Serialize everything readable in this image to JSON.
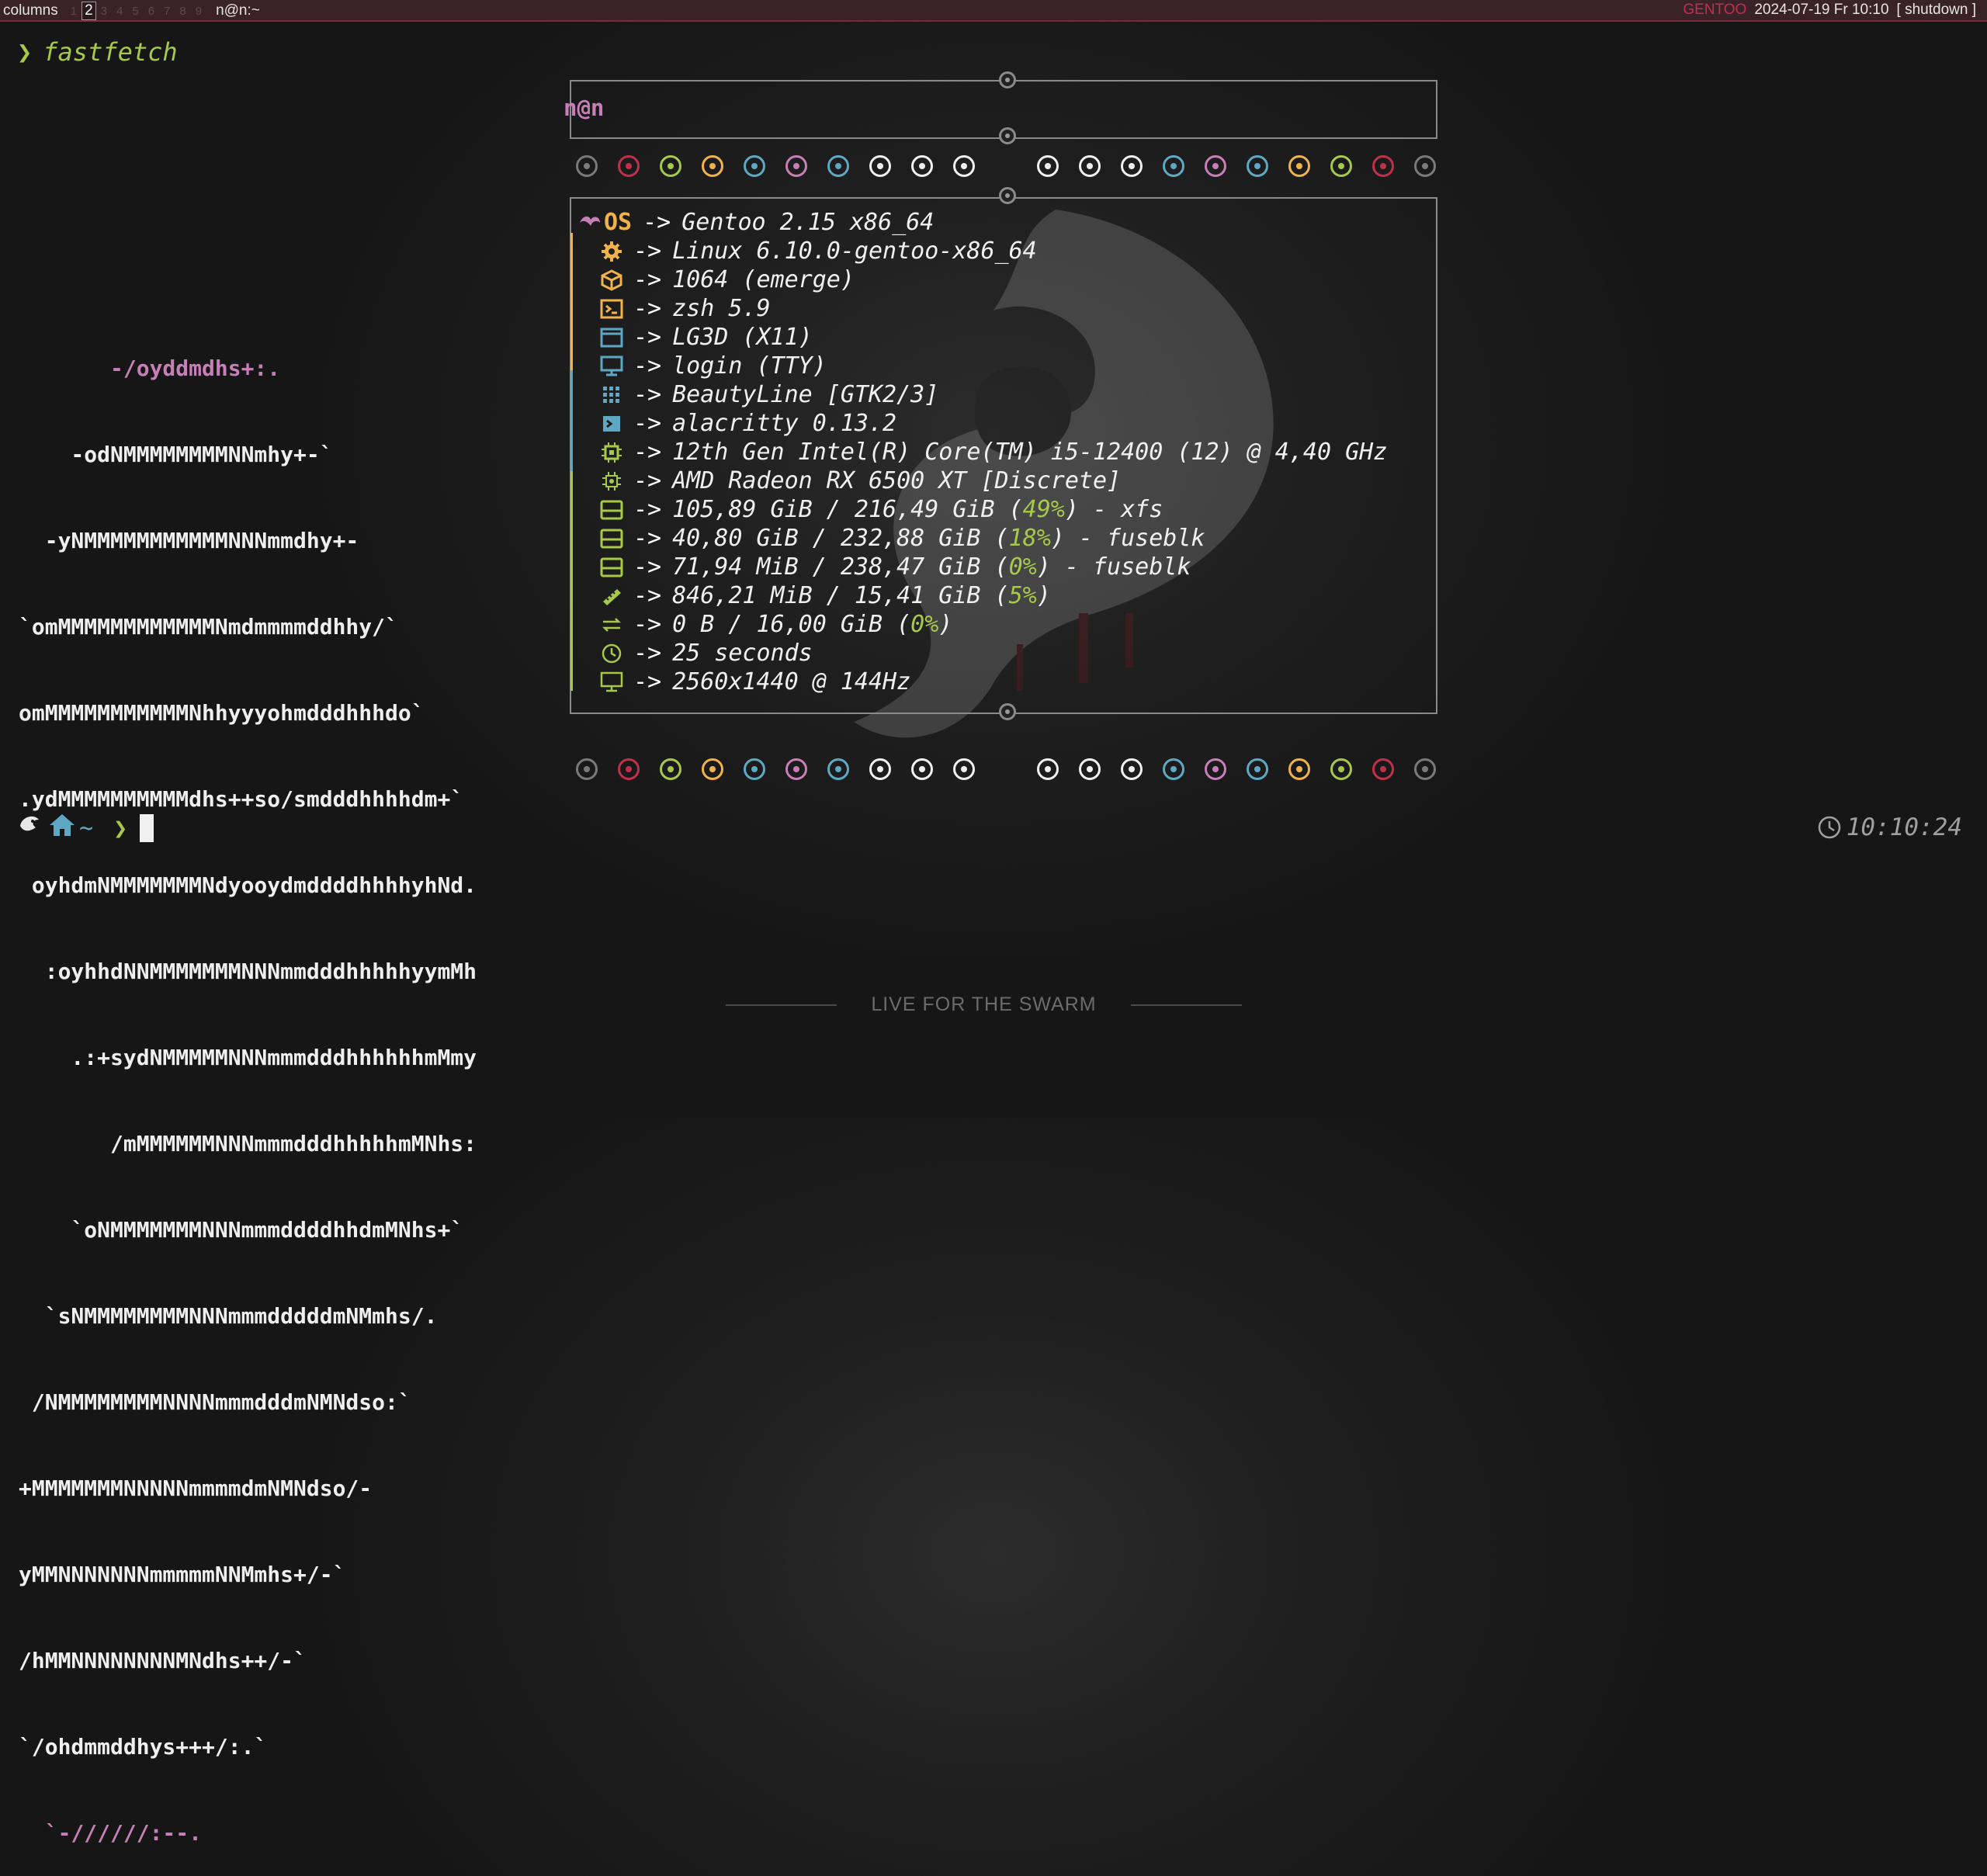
{
  "topbar": {
    "layout": "columns",
    "workspaces": [
      "1",
      "2",
      "3",
      "4",
      "5",
      "6",
      "7",
      "8",
      "9"
    ],
    "active_workspace": "2",
    "window_title": "n@n:~",
    "distro": "GENTOO",
    "datetime": "2024-07-19 Fr 10:10",
    "shutdown_label": "[ shutdown ]"
  },
  "terminal": {
    "prompt_symbol": "❯",
    "command": "fastfetch",
    "ascii_art": [
      "       -/oyddmdhs+:.",
      "    -odNMMMMMMMMNNmhy+-`",
      "  -yNMMMMMMMMMMMNNNmmdhy+-",
      "`omMMMMMMMMMMMMNmdmmmmddhhy/`",
      "omMMMMMMMMMMMNhhyyyohmdddhhhdo`",
      ".ydMMMMMMMMMMdhs++so/smdddhhhhdm+`",
      " oyhdmNMMMMMMMNdyooydmddddhhhhyhNd.",
      "  :oyhhdNNMMMMMMMNNNmmdddhhhhhyymMh",
      "    .:+sydNMMMMMNNNmmmdddhhhhhhmMmy",
      "       /mMMMMMMNNNmmmdddhhhhhmMNhs:",
      "    `oNMMMMMMMNNNmmmddddhhdmMNhs+`",
      "  `sNMMMMMMMMNNNmmmdddddmNMmhs/.",
      " /NMMMMMMMMNNNNmmmdddmNMNdso:`",
      "+MMMMMMMNNNNNmmmmdmNMNdso/-",
      "yMMNNNNNNNmmmmmNNMmhs+/-`",
      "/hMMNNNNNNNNMNdhs++/-`",
      "`/ohdmmddhys+++/:.`",
      "  `-//////:--."
    ],
    "home_symbol": "~",
    "clock": "10:10:24"
  },
  "fetch": {
    "user_host": "n@n",
    "arrow": "->",
    "os_label": "OS",
    "rows": [
      {
        "icon": "gentoo-icon",
        "text": "Gentoo 2.15 x86_64"
      },
      {
        "icon": "gear-icon",
        "text": "Linux 6.10.0-gentoo-x86_64"
      },
      {
        "icon": "package-icon",
        "text": "1064 (emerge)"
      },
      {
        "icon": "terminal-icon",
        "text": "zsh 5.9"
      },
      {
        "icon": "window-icon",
        "text": "LG3D (X11)"
      },
      {
        "icon": "monitor-icon",
        "text": "login (TTY)"
      },
      {
        "icon": "grid-icon",
        "text": "BeautyLine [GTK2/3]"
      },
      {
        "icon": "console-icon",
        "text": "alacritty 0.13.2"
      },
      {
        "icon": "cpu-icon",
        "text": "12th Gen Intel(R) Core(TM) i5-12400 (12) @ 4,40 GHz"
      },
      {
        "icon": "gpu-icon",
        "text": "AMD Radeon RX 6500 XT [Discrete]"
      },
      {
        "icon": "disk-icon",
        "pre": "105,89 GiB / 216,49 GiB (",
        "pct": "49%",
        "post": ") - xfs"
      },
      {
        "icon": "disk-icon",
        "pre": "40,80 GiB / 232,88 GiB (",
        "pct": "18%",
        "post": ") - fuseblk"
      },
      {
        "icon": "disk-icon",
        "pre": "71,94 MiB / 238,47 GiB (",
        "pct": "0%",
        "post": ") - fuseblk"
      },
      {
        "icon": "memory-icon",
        "pre": "846,21 MiB / 15,41 GiB (",
        "pct": "5%",
        "post": ")"
      },
      {
        "icon": "swap-icon",
        "pre": "0 B / 16,00 GiB (",
        "pct": "0%",
        "post": ")"
      },
      {
        "icon": "clock-icon",
        "text": "25 seconds"
      },
      {
        "icon": "display-icon",
        "text": "2560x1440 @ 144Hz"
      }
    ]
  },
  "palette": {
    "dots": [
      "#7a7a7a",
      "#c0304a",
      "#a6c94a",
      "#f0b24a",
      "#5fa8c4",
      "#c77fb7",
      "#5fa8c4",
      "#f0f0f0",
      "#f0f0f0",
      "#f0f0f0",
      "#f0f0f0",
      "#f0f0f0",
      "#f0f0f0",
      "#5fa8c4",
      "#c77fb7",
      "#5fa8c4",
      "#f0b24a",
      "#a6c94a",
      "#c0304a",
      "#7a7a7a"
    ]
  },
  "footer": {
    "text": "LIVE FOR THE SWARM"
  }
}
